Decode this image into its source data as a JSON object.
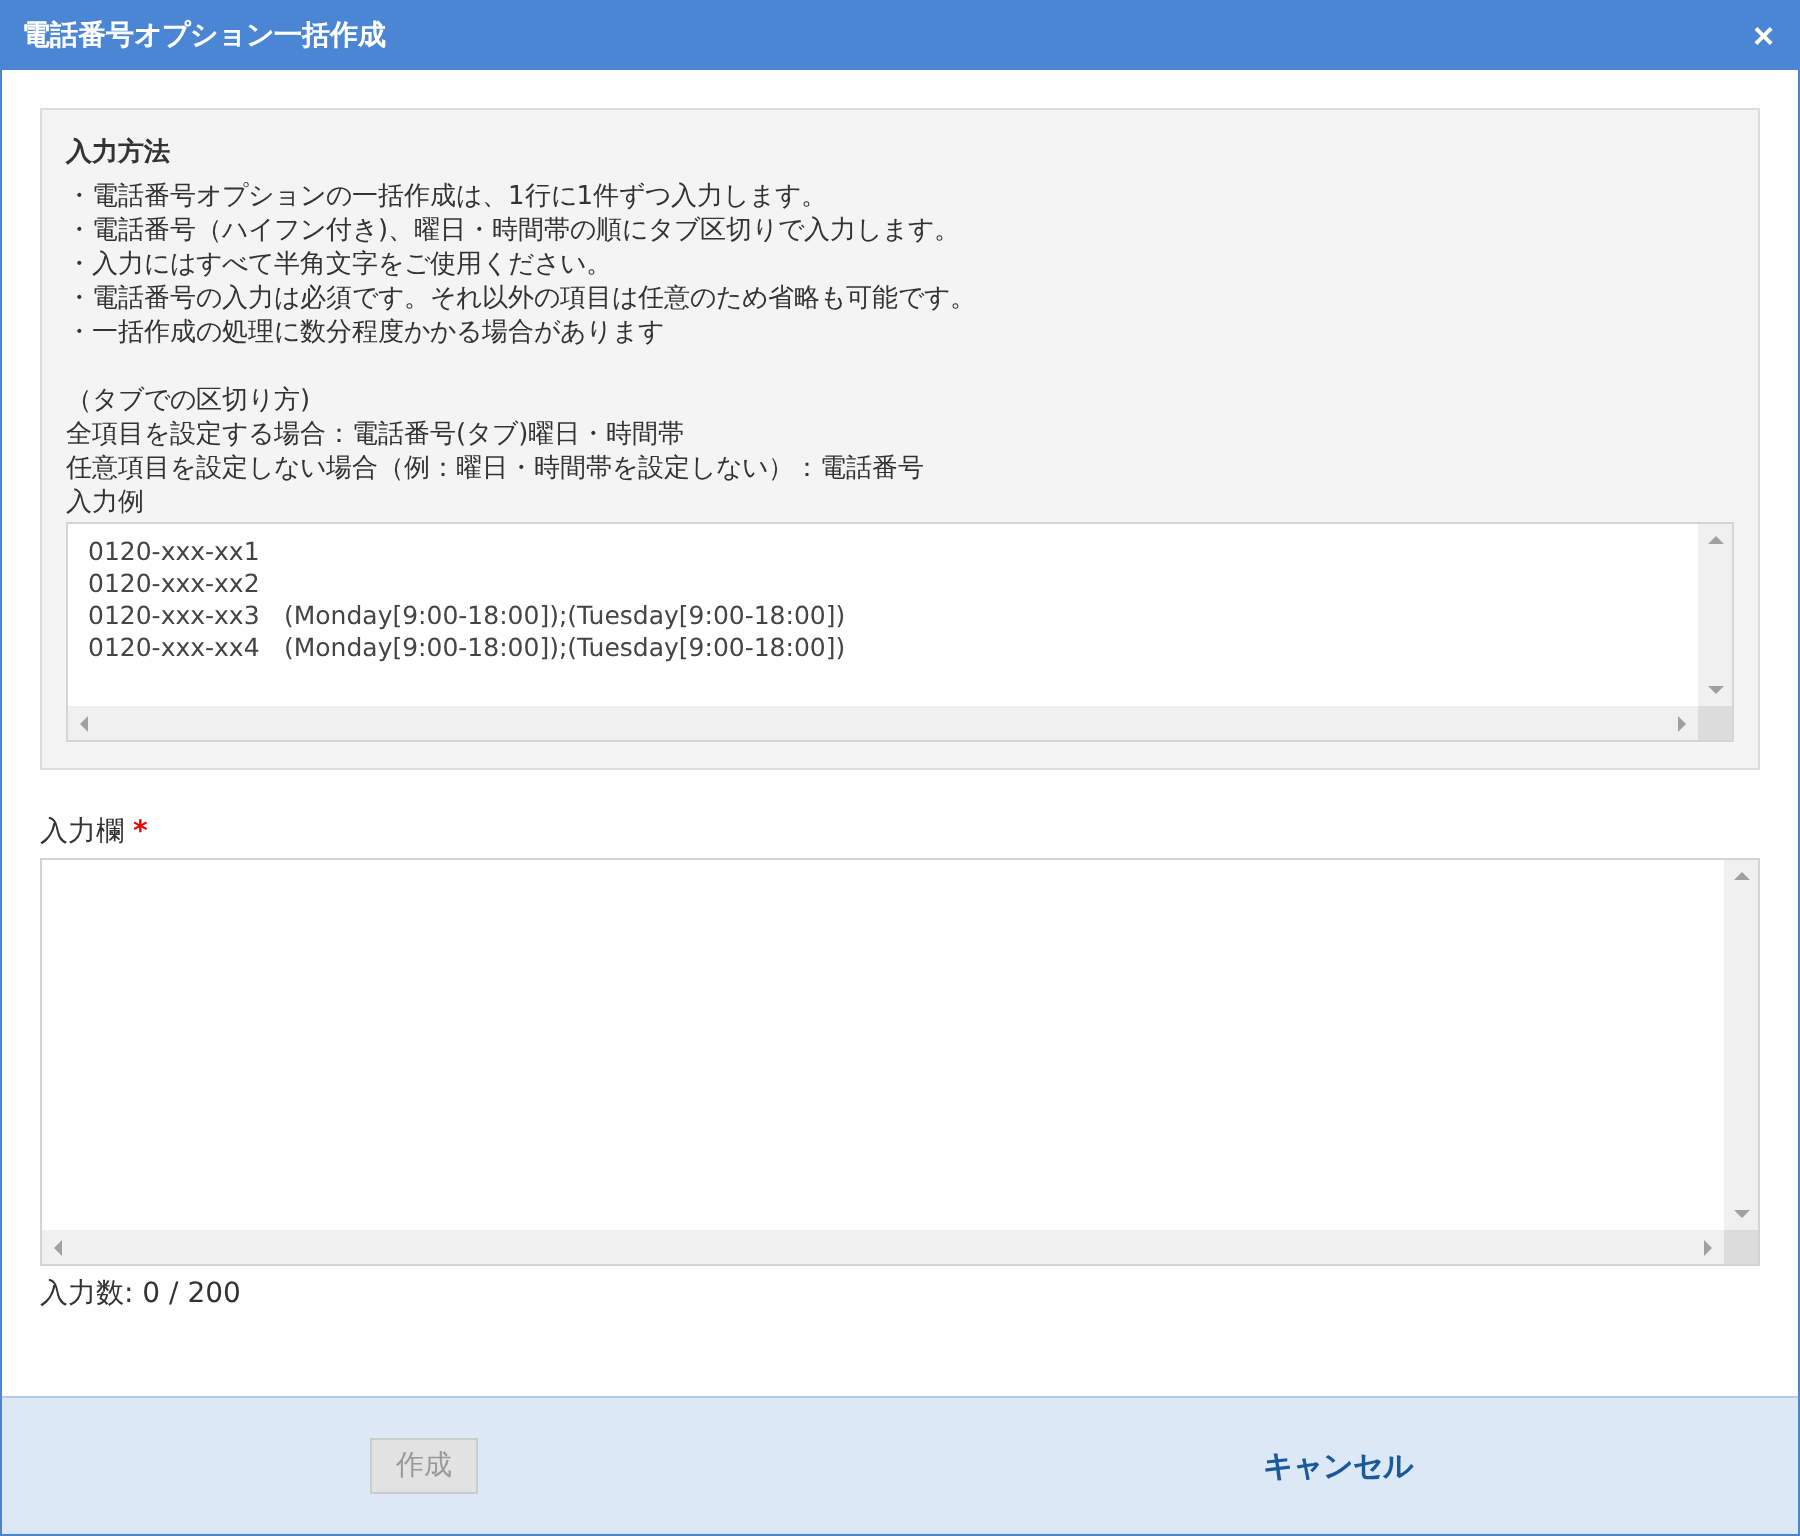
{
  "window": {
    "title": "電話番号オプション一括作成",
    "close": "×"
  },
  "instructions": {
    "heading": "入力方法",
    "bullets": [
      "・電話番号オプションの一括作成は、1行に1件ずつ入力します。",
      "・電話番号（ハイフン付き)、曜日・時間帯の順にタブ区切りで入力します。",
      "・入力にはすべて半角文字をご使用ください。",
      "・電話番号の入力は必須です。それ以外の項目は任意のため省略も可能です。",
      "・一括作成の処理に数分程度かかる場合があります"
    ],
    "notes": [
      "（タブでの区切り方)",
      "全項目を設定する場合：電話番号(タブ)曜日・時間帯",
      "任意項目を設定しない場合（例：曜日・時間帯を設定しない）：電話番号"
    ],
    "example_label": "入力例",
    "example_lines": [
      {
        "phone": "0120-xxx-xx1"
      },
      {
        "phone": "0120-xxx-xx2"
      },
      {
        "phone": "0120-xxx-xx3",
        "schedule": "(Monday[9:00-18:00]);(Tuesday[9:00-18:00])"
      },
      {
        "phone": "0120-xxx-xx4",
        "schedule": "(Monday[9:00-18:00]);(Tuesday[9:00-18:00])"
      }
    ]
  },
  "input": {
    "label": "入力欄",
    "required_mark": "*",
    "count": "入力数: 0 / 200"
  },
  "buttons": [
    {
      "label": "作成",
      "kind": "primary",
      "disabled": true
    },
    {
      "label": "キャンセル",
      "kind": "link",
      "disabled": false
    }
  ]
}
